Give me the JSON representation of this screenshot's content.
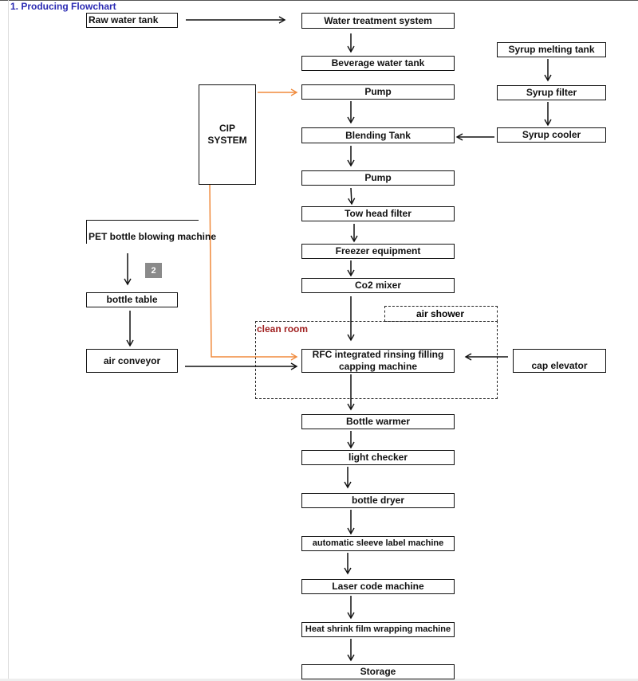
{
  "title": "1. Producing Flowchart",
  "colors": {
    "title": "#2b2bb3",
    "cip_line": "#f08a3c",
    "clean_room_label": "#a02020",
    "badge": "#8a8a8a"
  },
  "main_line": [
    "Water treatment system",
    "Beverage water tank",
    "Pump",
    "Blending Tank",
    "Pump",
    "Tow head filter",
    "Freezer equipment",
    "Co2 mixer",
    "RFC integrated rinsing filling capping  machine",
    "Bottle warmer",
    "light checker",
    "bottle dryer",
    "automatic sleeve label machine",
    "Laser code machine",
    "Heat shrink film wrapping machine",
    "Storage"
  ],
  "raw_water": "Raw water tank",
  "syrup_line": [
    "Syrup melting tank",
    "Syrup filter",
    "Syrup cooler"
  ],
  "cip": "CIP SYSTEM",
  "bottle_line": [
    "PET bottle blowing machine",
    "bottle table",
    "air conveyor"
  ],
  "cap_elevator": "cap elevator",
  "clean_room": "clean room",
  "air_shower": "air shower",
  "badge": "2"
}
